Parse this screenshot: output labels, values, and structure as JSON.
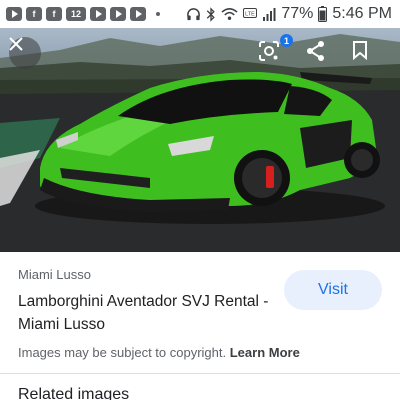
{
  "status_bar": {
    "apps": [
      {
        "name": "youtube-app-icon",
        "glyph": ""
      },
      {
        "name": "facebook-app-icon",
        "glyph": "f"
      },
      {
        "name": "facebook-app-icon",
        "glyph": "f"
      },
      {
        "name": "channel12-app-icon",
        "glyph": "12"
      },
      {
        "name": "youtube-app-icon",
        "glyph": ""
      },
      {
        "name": "youtube-app-icon",
        "glyph": ""
      },
      {
        "name": "youtube-app-icon",
        "glyph": ""
      }
    ],
    "battery": "77%",
    "time": "5:46 PM"
  },
  "viewer": {
    "lens_badge_count": "1",
    "image_subject": "green Lamborghini Aventador SVJ"
  },
  "result": {
    "source": "Miami Lusso",
    "title": "Lamborghini Aventador SVJ Rental - Miami Lusso",
    "visit_label": "Visit",
    "copyright_text": "Images may be subject to copyright.",
    "learn_more_label": "Learn More",
    "related_label": "Related images"
  },
  "colors": {
    "accent": "#1a73e8",
    "visit_bg": "#e8f0fe",
    "car_green": "#3fbf1f"
  }
}
